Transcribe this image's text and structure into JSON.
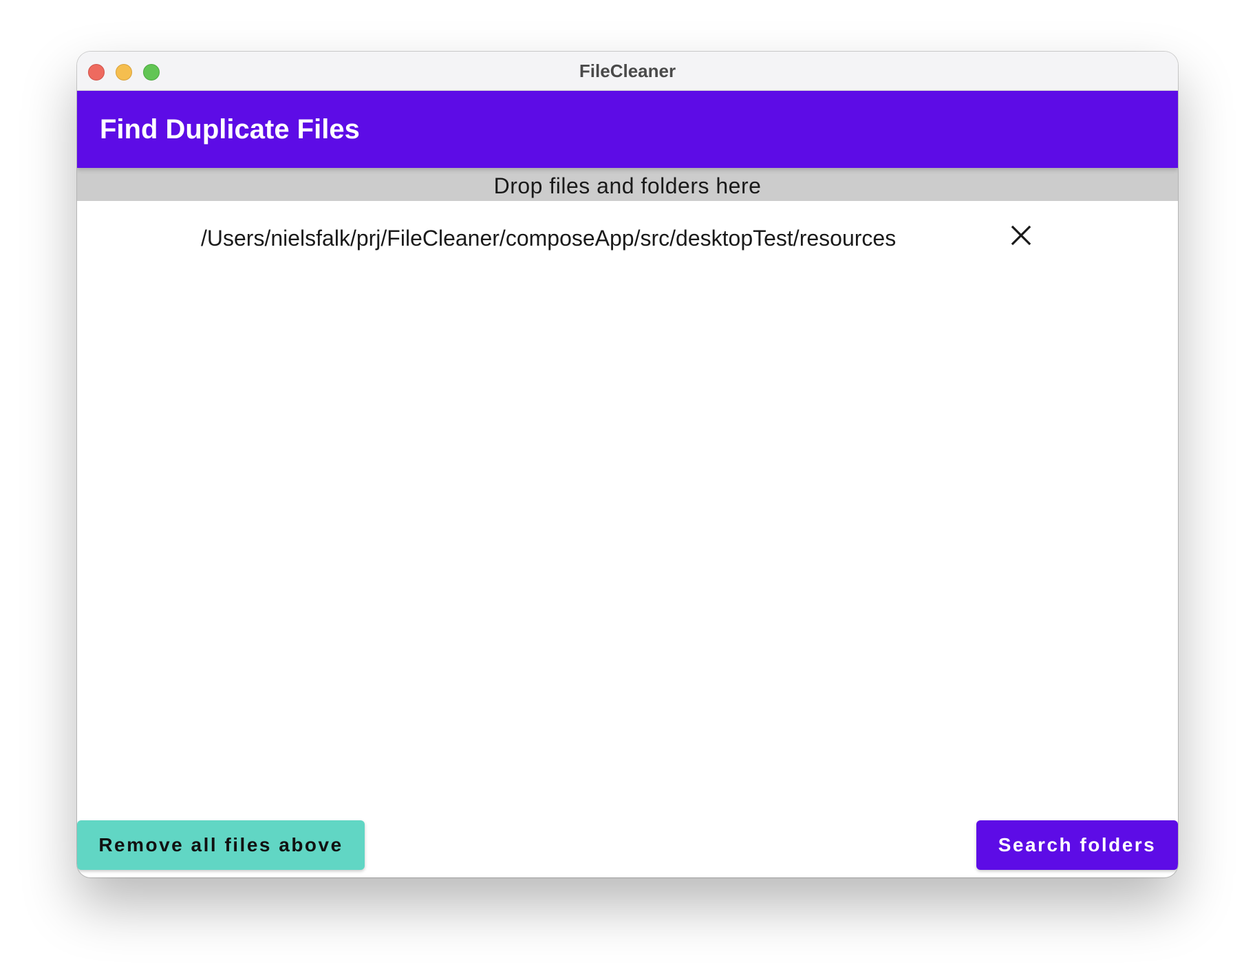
{
  "window": {
    "title": "FileCleaner"
  },
  "header": {
    "title": "Find Duplicate Files",
    "background": "#5d0ce6"
  },
  "drop_zone": {
    "label": "Drop files and folders here"
  },
  "files": [
    {
      "path": "/Users/nielsfalk/prj/FileCleaner/composeApp/src/desktopTest/resources",
      "remove_icon": "close-icon"
    }
  ],
  "actions": {
    "remove_all_label": "Remove all files above",
    "remove_all_color": "#61d6c4",
    "search_label": "Search folders",
    "search_color": "#5d0ce6"
  }
}
